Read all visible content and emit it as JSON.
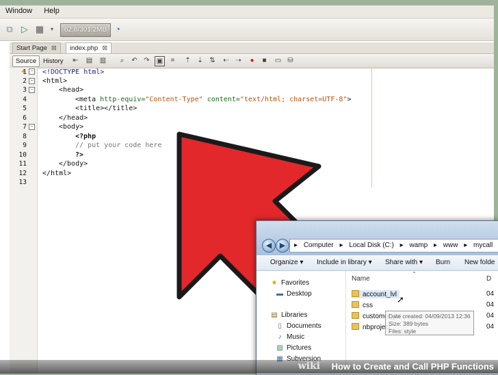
{
  "menu": [
    "Window",
    "Help"
  ],
  "toolbar": {
    "memory": "62.8/301.2MB"
  },
  "tabs": [
    {
      "label": "Start Page",
      "close": "⊠"
    },
    {
      "label": "index.php",
      "close": "⊠"
    }
  ],
  "editor_bar": {
    "source": "Source",
    "history": "History"
  },
  "editor": {
    "line_numbers": [
      "1",
      "2",
      "3",
      "4",
      "5",
      "6",
      "7",
      "8",
      "9",
      "10",
      "11",
      "12",
      "13"
    ],
    "lines": [
      "<!DOCTYPE html>",
      "<html>",
      "<head>",
      "<meta",
      "<title></title>",
      "</head>",
      "<body>",
      "<?php",
      "// put your code here",
      "?>",
      "</body>",
      "</html>"
    ],
    "meta_attr1": "http-equiv=",
    "meta_val1": "\"Content-Type\"",
    "meta_attr2": "content=",
    "meta_val2": "\"text/html; charset=UTF-8\"",
    "meta_close": ">"
  },
  "explorer": {
    "breadcrumb": [
      "Computer",
      "Local Disk (C:)",
      "wamp",
      "www",
      "mycall"
    ],
    "commands": [
      "Organize ▾",
      "Include in library ▾",
      "Share with ▾",
      "Burn",
      "New folde"
    ],
    "nav": {
      "favorites": "Favorites",
      "desktop": "Desktop",
      "libraries": "Libraries",
      "documents": "Documents",
      "music": "Music",
      "pictures": "Pictures",
      "subversion": "Subversion"
    },
    "column_name": "Name",
    "column_date": "D",
    "files": [
      "account_lvl",
      "css",
      "customer_lvl",
      "nbproject"
    ],
    "file_dates": [
      "04",
      "04",
      "04",
      "04"
    ],
    "tooltip": [
      "Date created: 04/09/2013 12:36",
      "Size: 389 bytes",
      "Files: style"
    ]
  },
  "caption": {
    "brand": "wiki",
    "text": "How to Create and Call PHP Functions"
  },
  "colors": {
    "arrow": "#e3282b",
    "arrow_outline": "#1a1a1a"
  }
}
